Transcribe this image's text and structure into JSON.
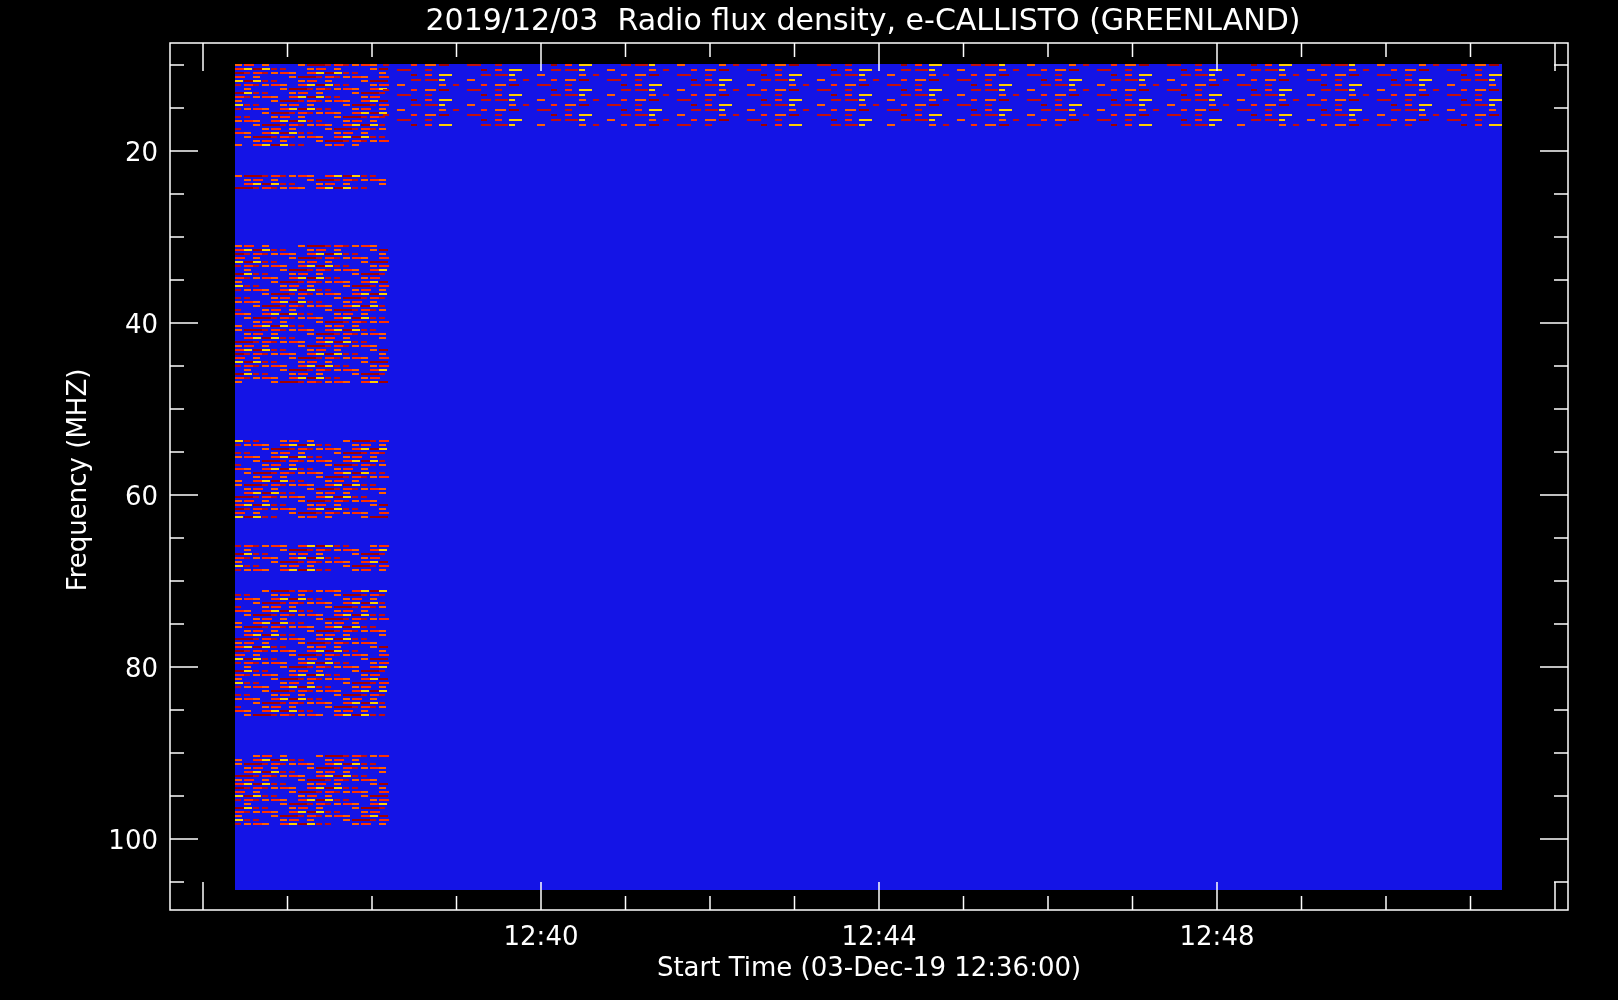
{
  "plot": {
    "title": "2019/12/03  Radio flux density, e-CALLISTO (GREENLAND)",
    "y_axis": {
      "label": "Frequency (MHZ)",
      "ticks": [
        "20",
        "40",
        "60",
        "80",
        "100"
      ]
    },
    "x_axis": {
      "label": "Start Time (03-Dec-19 12:36:00)",
      "ticks": [
        "12:40",
        "12:44",
        "12:48"
      ]
    }
  }
}
